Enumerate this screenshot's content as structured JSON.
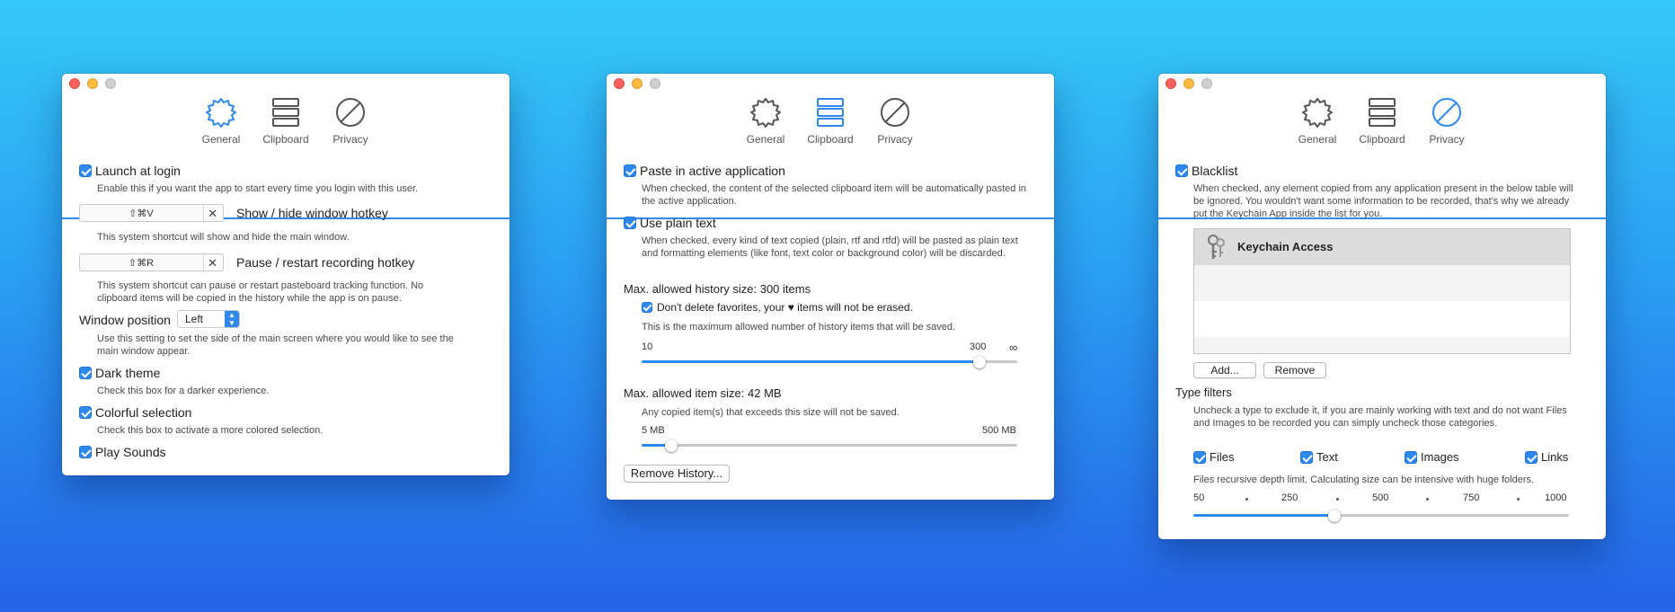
{
  "toolbar": {
    "general": "General",
    "clipboard": "Clipboard",
    "privacy": "Privacy"
  },
  "general": {
    "launch_label": "Launch at login",
    "launch_help": "Enable this if you want the app to start every time you login with this user.",
    "hotkey1_value": "⇧⌘V",
    "hotkey1_clear": "✕",
    "hotkey1_label": "Show / hide window hotkey",
    "hotkey1_help": "This system shortcut will show and hide the main window.",
    "hotkey2_value": "⇧⌘R",
    "hotkey2_clear": "✕",
    "hotkey2_label": "Pause / restart recording hotkey",
    "hotkey2_help": "This system shortcut can pause or restart pasteboard tracking function. No clipboard items will be copied in the history while the app is on pause.",
    "position_label": "Window position",
    "position_value": "Left",
    "position_help": "Use this setting to set the side of the main screen where you would like to see the main window appear.",
    "dark_label": "Dark theme",
    "dark_help": "Check this box for a darker experience.",
    "colorful_label": "Colorful selection",
    "colorful_help": "Check this box to activate a more colored selection.",
    "sounds_label": "Play Sounds"
  },
  "clipboard": {
    "paste_label": "Paste in active application",
    "paste_help": "When checked, the content of the selected clipboard item will be automatically pasted in the active application.",
    "plain_label": "Use plain text",
    "plain_help": "When checked, every kind of text copied (plain, rtf and rtfd) will be pasted as plain text and formatting elements (like font, text color or background color) will be discarded.",
    "history_heading": "Max. allowed history size: 300 items",
    "favorites_label": "Don't delete favorites, your ♥ items will not be erased.",
    "history_help": "This is the maximum allowed number of history items that will be saved.",
    "history_min": "10",
    "history_current": "300",
    "history_max": "∞",
    "history_level": 0.9,
    "item_heading": "Max. allowed item size: 42 MB",
    "item_help": "Any copied item(s) that exceeds this size will not be saved.",
    "item_min": "5 MB",
    "item_max": "500 MB",
    "item_level": 0.08,
    "remove_button": "Remove History..."
  },
  "privacy": {
    "blacklist_label": "Blacklist",
    "blacklist_help": "When checked, any element copied from any application present in the below table will be ignored. You wouldn't want some information to be recorded, that's why we already put the Keychain App inside the list for you.",
    "apps": [
      "Keychain Access"
    ],
    "add_button": "Add...",
    "remove_button": "Remove",
    "filters_heading": "Type filters",
    "filters_help": "Uncheck a type to exclude it, if you are mainly working with text and do not want Files and Images to be recorded you can simply uncheck those categories.",
    "filter_files": "Files",
    "filter_text": "Text",
    "filter_images": "Images",
    "filter_links": "Links",
    "depth_help": "Files recursive depth limit. Calculating size can be intensive with huge folders.",
    "depth_ticks": [
      "50",
      "250",
      "500",
      "750",
      "1000"
    ],
    "depth_level": 0.375
  },
  "colors": {
    "accent": "#2f88ee",
    "background_top": "#35c9f7",
    "background_bottom": "#2563e6"
  }
}
